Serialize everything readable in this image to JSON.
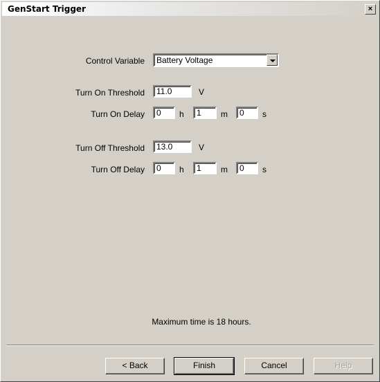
{
  "window": {
    "title": "GenStart Trigger",
    "close_glyph": "×"
  },
  "control_variable": {
    "label": "Control Variable",
    "value": "Battery Voltage"
  },
  "turn_on": {
    "threshold_label": "Turn On Threshold",
    "threshold_value": "11.0",
    "threshold_unit": "V",
    "delay_label": "Turn On Delay",
    "hours": "0",
    "hours_unit": "h",
    "minutes": "1",
    "minutes_unit": "m",
    "seconds": "0",
    "seconds_unit": "s"
  },
  "turn_off": {
    "threshold_label": "Turn Off Threshold",
    "threshold_value": "13.0",
    "threshold_unit": "V",
    "delay_label": "Turn Off Delay",
    "hours": "0",
    "hours_unit": "h",
    "minutes": "1",
    "minutes_unit": "m",
    "seconds": "0",
    "seconds_unit": "s"
  },
  "note": "Maximum time is 18 hours.",
  "buttons": {
    "back": "< Back",
    "finish": "Finish",
    "cancel": "Cancel",
    "help": "Help"
  }
}
